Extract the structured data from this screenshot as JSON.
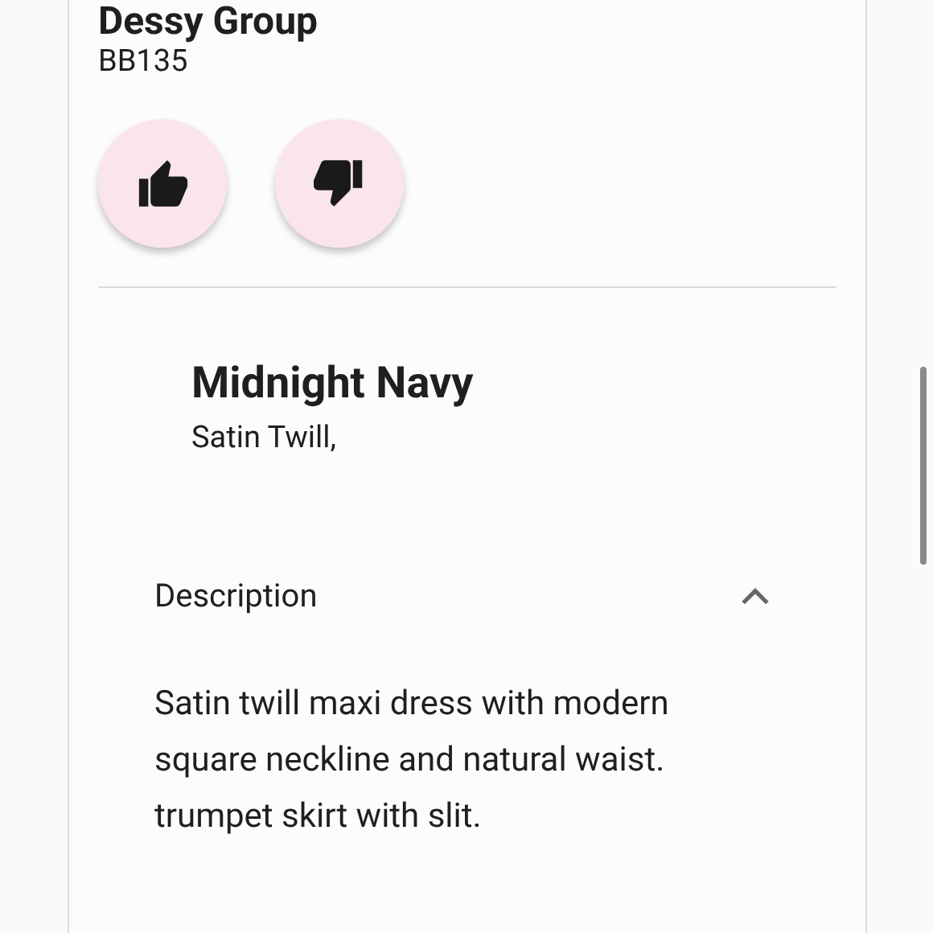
{
  "product": {
    "brand": "Dessy Group",
    "code": "BB135"
  },
  "reactions": [
    {
      "kind": "like"
    },
    {
      "kind": "dislike"
    }
  ],
  "color": {
    "name": "Midnight Navy",
    "fabric": "Satin Twill,"
  },
  "description": {
    "title": "Description",
    "expanded": true,
    "text": "Satin twill maxi dress with modern square neckline and natural waist. trumpet skirt with slit."
  }
}
